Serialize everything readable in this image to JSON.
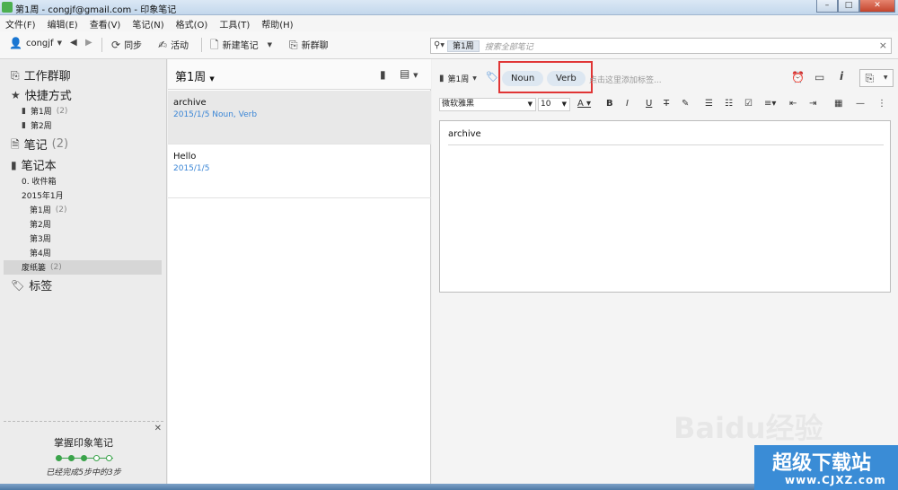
{
  "window": {
    "title": "第1周 - congjf@gmail.com - 印象笔记"
  },
  "menu": [
    "文件(F)",
    "编辑(E)",
    "查看(V)",
    "笔记(N)",
    "格式(O)",
    "工具(T)",
    "帮助(H)"
  ],
  "toolbar": {
    "user": "congjf",
    "sync": "同步",
    "activity": "活动",
    "new_note": "新建笔记",
    "new_chat": "新群聊"
  },
  "search": {
    "scope": "第1周",
    "placeholder": "搜索全部笔记"
  },
  "sidebar": {
    "work_chat": "工作群聊",
    "shortcuts": "快捷方式",
    "shortcut_items": [
      {
        "label": "第1周",
        "count": "(2)"
      },
      {
        "label": "第2周",
        "count": ""
      }
    ],
    "notes": "笔记",
    "notes_count": "(2)",
    "notebooks": "笔记本",
    "inbox": "0. 收件箱",
    "stack": "2015年1月",
    "weeks": [
      {
        "label": "第1周",
        "count": "(2)"
      },
      {
        "label": "第2周",
        "count": ""
      },
      {
        "label": "第3周",
        "count": ""
      },
      {
        "label": "第4周",
        "count": ""
      }
    ],
    "trash": "废纸篓",
    "trash_count": "(2)",
    "tags": "标签"
  },
  "tips": {
    "title": "掌握印象笔记",
    "subtitle": "已经完成5步中的3步",
    "steps_total": 5,
    "steps_done": 3
  },
  "notelist": {
    "title": "第1周",
    "notes": [
      {
        "title": "archive",
        "meta": "2015/1/5  Noun, Verb"
      },
      {
        "title": "Hello",
        "meta": "2015/1/5"
      }
    ]
  },
  "editor": {
    "notebook": "第1周",
    "tags": [
      "Noun",
      "Verb"
    ],
    "tag_placeholder": "点击这里添加标签...",
    "font": "微软雅黑",
    "size": "10",
    "note_title": "archive"
  },
  "watermark": {
    "line1": "超级下载站",
    "line2": "www.CJXZ.com",
    "baidu": "Baidu经验"
  },
  "colors": {
    "accent": "#3b86d6",
    "highlight": "#e03535",
    "progress": "#3aa34a"
  }
}
